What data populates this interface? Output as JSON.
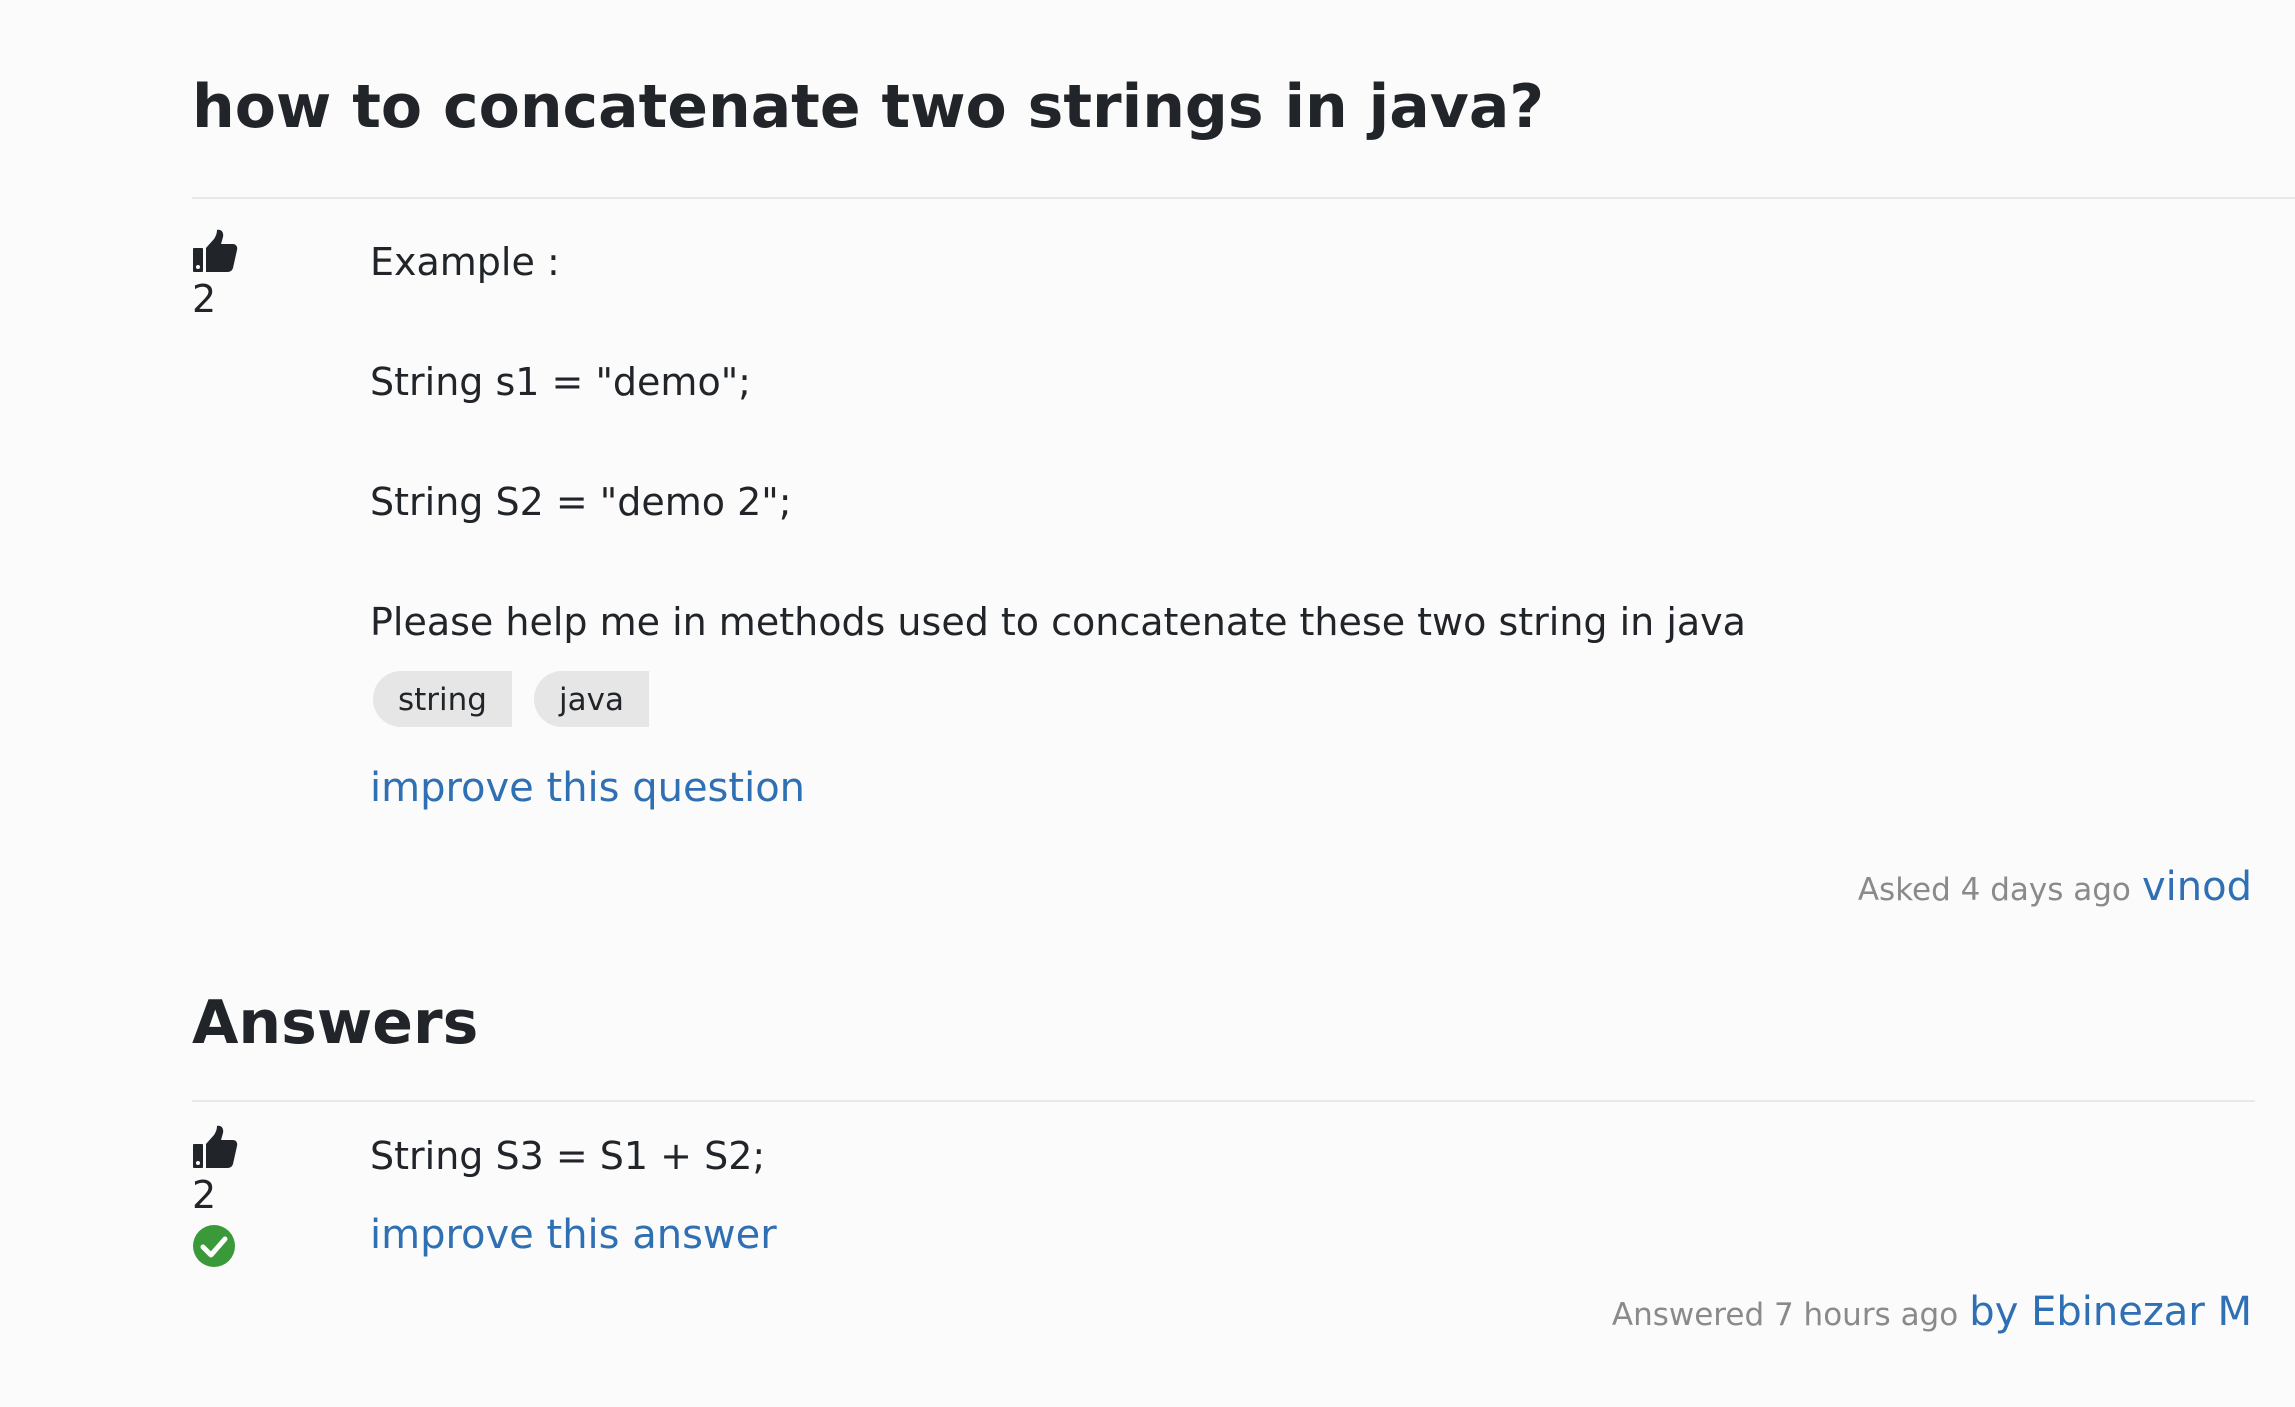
{
  "question": {
    "title": "how to concatenate two strings in java?",
    "votes": "2",
    "body": [
      "Example :",
      "String s1 = \"demo\";",
      "String S2 = \"demo 2\";",
      "Please help me in methods used to concatenate these two string in java"
    ],
    "tags": [
      "string",
      "java"
    ],
    "improve_label": "improve this question",
    "asked_label": "Asked 4 days ago",
    "author": "vinod"
  },
  "answers_heading": "Answers",
  "answers": [
    {
      "votes": "2",
      "accepted": true,
      "body": [
        "String S3 = S1 + S2;"
      ],
      "improve_label": "improve this answer",
      "answered_label": "Answered 7 hours ago",
      "author": "by Ebinezar M"
    }
  ],
  "colors": {
    "link": "#2f6fb3",
    "accepted": "#3a9a3a",
    "tag_bg": "#e6e6e6",
    "meta_text": "#8a8a8a"
  },
  "icons": {
    "vote": "thumbs-up-icon",
    "accepted": "check-circle-icon"
  }
}
